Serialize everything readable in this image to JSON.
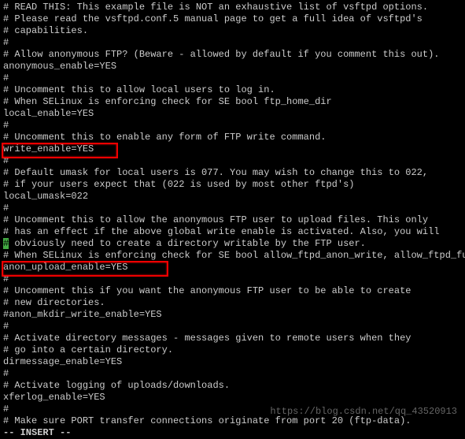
{
  "lines": [
    "# READ THIS: This example file is NOT an exhaustive list of vsftpd options.",
    "# Please read the vsftpd.conf.5 manual page to get a full idea of vsftpd's",
    "# capabilities.",
    "#",
    "# Allow anonymous FTP? (Beware - allowed by default if you comment this out).",
    "anonymous_enable=YES",
    "#",
    "# Uncomment this to allow local users to log in.",
    "# When SELinux is enforcing check for SE bool ftp_home_dir",
    "local_enable=YES",
    "#",
    "# Uncomment this to enable any form of FTP write command.",
    "write_enable=YES",
    "#",
    "# Default umask for local users is 077. You may wish to change this to 022,",
    "# if your users expect that (022 is used by most other ftpd's)",
    "local_umask=022",
    "#",
    "# Uncomment this to allow the anonymous FTP user to upload files. This only",
    "# has an effect if the above global write enable is activated. Also, you will",
    {
      "pre": "",
      "cursor": "#",
      "post": " obviously need to create a directory writable by the FTP user."
    },
    "# When SELinux is enforcing check for SE bool allow_ftpd_anon_write, allow_ftpd_full_",
    "anon_upload_enable=YES",
    "#",
    "# Uncomment this if you want the anonymous FTP user to be able to create",
    "# new directories.",
    "#anon_mkdir_write_enable=YES",
    "#",
    "# Activate directory messages - messages given to remote users when they",
    "# go into a certain directory.",
    "dirmessage_enable=YES",
    "#",
    "# Activate logging of uploads/downloads.",
    "xferlog_enable=YES",
    "#",
    "# Make sure PORT transfer connections originate from port 20 (ftp-data)."
  ],
  "mode": "-- INSERT --",
  "watermark": "https://blog.csdn.net/qq_43520913"
}
